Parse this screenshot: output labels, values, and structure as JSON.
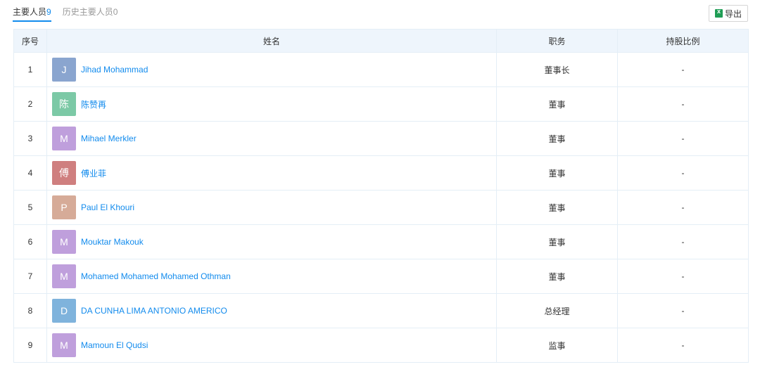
{
  "tabs": [
    {
      "label": "主要人员",
      "count": "9"
    },
    {
      "label": "历史主要人员",
      "count": "0"
    }
  ],
  "export_label": "导出",
  "columns": {
    "index": "序号",
    "name": "姓名",
    "role": "职务",
    "share": "持股比例"
  },
  "rows": [
    {
      "index": "1",
      "avatar": "J",
      "avatar_color": "#8aa5cf",
      "name": "Jihad Mohammad",
      "role": "董事长",
      "share": "-"
    },
    {
      "index": "2",
      "avatar": "陈",
      "avatar_color": "#7cc9a6",
      "name": "陈赞再",
      "role": "董事",
      "share": "-"
    },
    {
      "index": "3",
      "avatar": "M",
      "avatar_color": "#bf9fdc",
      "name": "Mihael Merkler",
      "role": "董事",
      "share": "-"
    },
    {
      "index": "4",
      "avatar": "傅",
      "avatar_color": "#cf7f7f",
      "name": "傅业菲",
      "role": "董事",
      "share": "-"
    },
    {
      "index": "5",
      "avatar": "P",
      "avatar_color": "#d6ab98",
      "name": "Paul El Khouri",
      "role": "董事",
      "share": "-"
    },
    {
      "index": "6",
      "avatar": "M",
      "avatar_color": "#bf9fdc",
      "name": "Mouktar Makouk",
      "role": "董事",
      "share": "-"
    },
    {
      "index": "7",
      "avatar": "M",
      "avatar_color": "#bf9fdc",
      "name": "Mohamed Mohamed Mohamed Othman",
      "role": "董事",
      "share": "-"
    },
    {
      "index": "8",
      "avatar": "D",
      "avatar_color": "#7fb3dc",
      "name": "DA CUNHA LIMA ANTONIO AMERICO",
      "role": "总经理",
      "share": "-"
    },
    {
      "index": "9",
      "avatar": "M",
      "avatar_color": "#bf9fdc",
      "name": "Mamoun El Qudsi",
      "role": "监事",
      "share": "-"
    }
  ],
  "colors": {
    "accent": "#128bed",
    "header_bg": "#eef5fc",
    "border": "#e4eef6"
  }
}
